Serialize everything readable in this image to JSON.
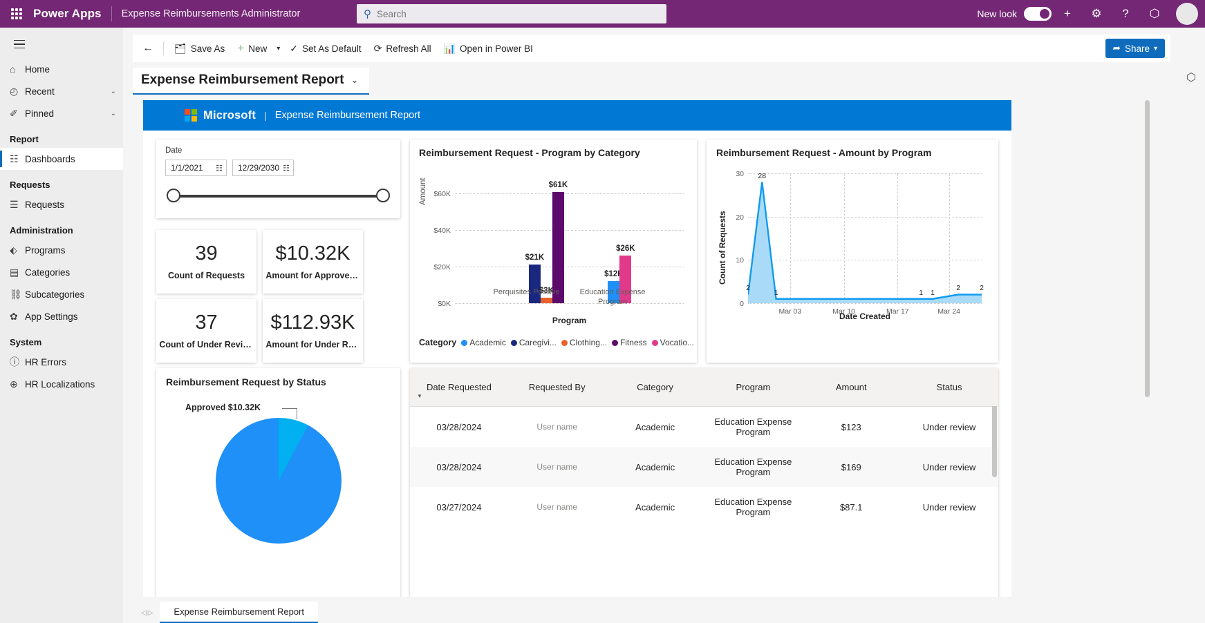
{
  "topbar": {
    "waffle_title": "app-launcher",
    "brand": "Power Apps",
    "app_name": "Expense Reimbursements Administrator",
    "search_placeholder": "Search",
    "search_value": "",
    "new_look_label": "New look",
    "new_look_on": true,
    "icons": {
      "plus": "+",
      "gear": "⚙",
      "help": "?",
      "copilot": "⬡"
    }
  },
  "sidebar": {
    "items": [
      {
        "label": "Home",
        "icon": "⌂",
        "chevron": "",
        "active": false
      },
      {
        "label": "Recent",
        "icon": "◴",
        "chevron": "⌄",
        "active": false
      },
      {
        "label": "Pinned",
        "icon": "✐",
        "chevron": "⌄",
        "active": false
      }
    ],
    "groups": [
      {
        "title": "Report",
        "items": [
          {
            "label": "Dashboards",
            "icon": "☷",
            "active": true
          }
        ]
      },
      {
        "title": "Requests",
        "items": [
          {
            "label": "Requests",
            "icon": "☰",
            "active": false
          }
        ]
      },
      {
        "title": "Administration",
        "items": [
          {
            "label": "Programs",
            "icon": "⬖",
            "active": false
          },
          {
            "label": "Categories",
            "icon": "▤",
            "active": false
          },
          {
            "label": "Subcategories",
            "icon": "⛓",
            "active": false
          },
          {
            "label": "App Settings",
            "icon": "✿",
            "active": false
          }
        ]
      },
      {
        "title": "System",
        "items": [
          {
            "label": "HR Errors",
            "icon": "ⓘ",
            "active": false
          },
          {
            "label": "HR Localizations",
            "icon": "⊕",
            "active": false
          }
        ]
      }
    ]
  },
  "commandbar": {
    "back_icon": "←",
    "save_as": "Save As",
    "new": "New",
    "set_as_default": "Set As Default",
    "refresh_all": "Refresh All",
    "open_in_power_bi": "Open in Power BI",
    "share": "Share"
  },
  "report_selector": {
    "title": "Expense Reimbursement Report",
    "chevron": "⌄"
  },
  "pbi_banner": {
    "logo_alt": "microsoft-logo",
    "wordmark": "Microsoft",
    "separator": "|",
    "title": "Expense Reimbursement Report"
  },
  "date_slicer": {
    "label": "Date",
    "start": "1/1/2021",
    "end": "12/29/2030",
    "calendar_icon": "☷"
  },
  "kpis": [
    {
      "value": "39",
      "label": "Count of Requests"
    },
    {
      "value": "$10.32K",
      "label": "Amount for Approved Re..."
    },
    {
      "value": "37",
      "label": "Count of Under Review Re..."
    },
    {
      "value": "$112.93K",
      "label": "Amount for Under Review..."
    }
  ],
  "chart_data": [
    {
      "type": "bar",
      "title": "Reimbursement Request - Program by Category",
      "xlabel": "Program",
      "ylabel": "Amount",
      "ylim": [
        0,
        65000
      ],
      "yticks": [
        "$0K",
        "$20K",
        "$40K",
        "$60K"
      ],
      "ytick_values": [
        0,
        20000,
        40000,
        60000
      ],
      "grid": true,
      "legend_title": "Category",
      "legend_position": "bottom",
      "categories": [
        "Perquisites Positive",
        "Education Expense Program"
      ],
      "series": [
        {
          "name": "Academic",
          "color": "#1f90f7",
          "values": [
            0,
            12000
          ],
          "labels": [
            "",
            "$12K"
          ]
        },
        {
          "name": "Caregivi...",
          "color": "#19277f",
          "values": [
            21000,
            0
          ],
          "labels": [
            "$21K",
            ""
          ]
        },
        {
          "name": "Clothing...",
          "color": "#e8612c",
          "values": [
            3000,
            0
          ],
          "labels": [
            "$3K",
            ""
          ]
        },
        {
          "name": "Fitness",
          "color": "#5c0a6b",
          "values": [
            61000,
            0
          ],
          "labels": [
            "$61K",
            ""
          ]
        },
        {
          "name": "Vocatio...",
          "color": "#e23a8a",
          "values": [
            0,
            26000
          ],
          "labels": [
            "",
            "$26K"
          ]
        }
      ]
    },
    {
      "type": "area",
      "title": "Reimbursement Request - Amount by Program",
      "xlabel": "Date Created",
      "ylabel": "Count of Requests",
      "ylim": [
        0,
        30
      ],
      "yticks": [
        "0",
        "10",
        "20",
        "30"
      ],
      "ytick_values": [
        0,
        10,
        20,
        30
      ],
      "xticks": [
        "Mar 03",
        "Mar 10",
        "Mar 17",
        "Mar 24"
      ],
      "grid": true,
      "line_color": "#0f9bf0",
      "fill_color": "#a9daf7",
      "points": [
        {
          "x": 0.0,
          "y": 2,
          "label": "2"
        },
        {
          "x": 0.06,
          "y": 28,
          "label": "28"
        },
        {
          "x": 0.12,
          "y": 1,
          "label": "1"
        },
        {
          "x": 0.3,
          "y": 1,
          "label": ""
        },
        {
          "x": 0.55,
          "y": 1,
          "label": ""
        },
        {
          "x": 0.74,
          "y": 1,
          "label": "1"
        },
        {
          "x": 0.79,
          "y": 1,
          "label": "1"
        },
        {
          "x": 0.9,
          "y": 2,
          "label": "2"
        },
        {
          "x": 1.0,
          "y": 2,
          "label": "2"
        }
      ]
    },
    {
      "type": "pie",
      "title": "Reimbursement Request by Status",
      "slices": [
        {
          "name": "Approved",
          "value": 10.32,
          "display": "Approved $10.32K",
          "color": "#00b0f0"
        },
        {
          "name": "Under review",
          "value": 112.93,
          "display": "",
          "color": "#1f90f7"
        }
      ]
    }
  ],
  "table": {
    "columns": [
      "Date Requested",
      "Requested By",
      "Category",
      "Program",
      "Amount",
      "Status"
    ],
    "rows": [
      {
        "date": "03/28/2024",
        "requested_by": "User name",
        "category": "Academic",
        "program": "Education Expense Program",
        "amount": "$123",
        "status": "Under review"
      },
      {
        "date": "03/28/2024",
        "requested_by": "User name",
        "category": "Academic",
        "program": "Education Expense Program",
        "amount": "$169",
        "status": "Under review"
      },
      {
        "date": "03/27/2024",
        "requested_by": "User name",
        "category": "Academic",
        "program": "Education Expense Program",
        "amount": "$87.1",
        "status": "Under review"
      }
    ]
  },
  "page_tabs": {
    "prev": "◁",
    "next": "▷",
    "tabs": [
      {
        "label": "Expense Reimbursement Report",
        "active": true
      }
    ]
  }
}
